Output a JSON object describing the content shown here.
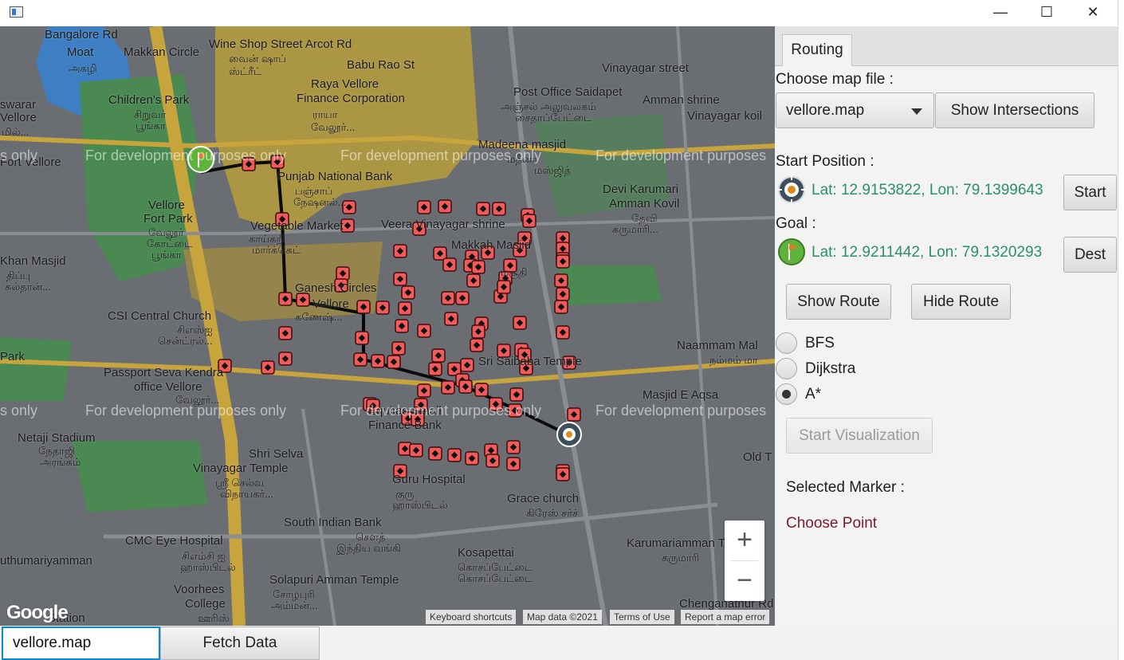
{
  "window": {
    "minimize_glyph": "—",
    "maximize_glyph": "☐",
    "close_glyph": "✕"
  },
  "map": {
    "labels": [
      {
        "id": "bangalore-rd",
        "text": "Bangalore Rd"
      },
      {
        "id": "moat",
        "text": "Moat"
      },
      {
        "id": "moat-tam",
        "text": "அகழி"
      },
      {
        "id": "makkan",
        "text": "Makkan Circle"
      },
      {
        "id": "wine",
        "text": "Wine Shop Street Arcot Rd"
      },
      {
        "id": "wine-tam",
        "text": "வைன் ஷாப்"
      },
      {
        "id": "wine-tam2",
        "text": "ஸ்ட்ரீட்"
      },
      {
        "id": "babu",
        "text": "Babu Rao St"
      },
      {
        "id": "raya",
        "text": "Raya Vellore"
      },
      {
        "id": "raya2",
        "text": "Finance Corporation"
      },
      {
        "id": "raya-tam",
        "text": "ராயா"
      },
      {
        "id": "raya-tam2",
        "text": "வேலூர்..."
      },
      {
        "id": "vinayagar",
        "text": "Vinayagar street"
      },
      {
        "id": "postoffice",
        "text": "Post Office Saidapet"
      },
      {
        "id": "postoffice-tam",
        "text": "அஞ்சல் அலுவலகம்"
      },
      {
        "id": "postoffice-tam2",
        "text": "சைதாப்பேட்டை"
      },
      {
        "id": "amman",
        "text": "Amman shrine"
      },
      {
        "id": "vinayagar-koil",
        "text": "Vinayagar koil"
      },
      {
        "id": "children",
        "text": "Children's Park"
      },
      {
        "id": "children-tam",
        "text": "சிறுவர்"
      },
      {
        "id": "children-tam2",
        "text": "பூங்கா"
      },
      {
        "id": "eswarar",
        "text": "swarar"
      },
      {
        "id": "eswarar2",
        "text": "Vellore"
      },
      {
        "id": "eswarar-tam",
        "text": "மில்..."
      },
      {
        "id": "madeena",
        "text": "Madeena masjid"
      },
      {
        "id": "madeena-tam",
        "text": "மதீனா"
      },
      {
        "id": "madeena-tam2",
        "text": "மஸ்ஜித்"
      },
      {
        "id": "fortvellore",
        "text": "Fort Vellore"
      },
      {
        "id": "punjab",
        "text": "Punjab National Bank"
      },
      {
        "id": "punjab-tam",
        "text": "பஞ்சாப்"
      },
      {
        "id": "punjab-tam2",
        "text": "நேஷனல்..."
      },
      {
        "id": "devi",
        "text": "Devi Karumari"
      },
      {
        "id": "devi2",
        "text": "Amman Kovil"
      },
      {
        "id": "devi-tam",
        "text": "தேவி"
      },
      {
        "id": "devi-tam2",
        "text": "கருமாரி..."
      },
      {
        "id": "fortpark",
        "text": "Vellore"
      },
      {
        "id": "fortpark2",
        "text": "Fort Park"
      },
      {
        "id": "fortpark-tam",
        "text": "வேலூர்"
      },
      {
        "id": "fortpark-tam2",
        "text": "கோட்டை"
      },
      {
        "id": "fortpark-tam3",
        "text": "பூங்கா"
      },
      {
        "id": "vegmarket",
        "text": "Vegetable Market"
      },
      {
        "id": "vegmarket-tam",
        "text": "காய்கறி"
      },
      {
        "id": "vegmarket-tam2",
        "text": "மார்க்கெட்"
      },
      {
        "id": "veera",
        "text": "Veera Vinayagar shrine"
      },
      {
        "id": "makkah",
        "text": "Makkah Masjid"
      },
      {
        "id": "makkah-tam",
        "text": "மசூதி"
      },
      {
        "id": "khan",
        "text": "Khan Masjid"
      },
      {
        "id": "khan-tam",
        "text": "திப்பு"
      },
      {
        "id": "khan-tam2",
        "text": "சுல்தான்..."
      },
      {
        "id": "ganesh",
        "text": "Ganesh Circles"
      },
      {
        "id": "ganesh2",
        "text": "Vellore"
      },
      {
        "id": "ganesh-tam",
        "text": "கணேஷ்..."
      },
      {
        "id": "csi",
        "text": "CSI Central Church"
      },
      {
        "id": "csi-tam",
        "text": "சிஎஸ்ஐ"
      },
      {
        "id": "csi-tam2",
        "text": "சென்ட்ரல்..."
      },
      {
        "id": "naammam",
        "text": "Naammam Mal"
      },
      {
        "id": "naammam-tam",
        "text": "நம்மம் மா"
      },
      {
        "id": "park",
        "text": "Park"
      },
      {
        "id": "passport",
        "text": "Passport Seva Kendra"
      },
      {
        "id": "passport2",
        "text": "office Vellore"
      },
      {
        "id": "passport-tam",
        "text": "வேலூர்..."
      },
      {
        "id": "saibaba",
        "text": "Sri Saibaba Temple"
      },
      {
        "id": "masjid-aqsa",
        "text": "Masjid E Aqsa"
      },
      {
        "id": "equitas",
        "text": "Equitas Small"
      },
      {
        "id": "equitas2",
        "text": "Finance Bank"
      },
      {
        "id": "netaji",
        "text": "Netaji Stadium"
      },
      {
        "id": "netaji-tam",
        "text": "நேதாஜி"
      },
      {
        "id": "netaji-tam2",
        "text": "அரங்கம்"
      },
      {
        "id": "shriselva",
        "text": "Shri Selva"
      },
      {
        "id": "shriselva2",
        "text": "Vinayagar Temple"
      },
      {
        "id": "shriselva-tam",
        "text": "ஸ்ரீ செல்வ"
      },
      {
        "id": "shriselva-tam2",
        "text": "விநாயகர்..."
      },
      {
        "id": "guru",
        "text": "Guru Hospital"
      },
      {
        "id": "guru-tam",
        "text": "குரு"
      },
      {
        "id": "guru-tam2",
        "text": "ஹாஸ்பிடல்"
      },
      {
        "id": "oldt",
        "text": "Old T"
      },
      {
        "id": "grace",
        "text": "Grace church"
      },
      {
        "id": "grace-tam",
        "text": "கிரேஸ் சர்ச்"
      },
      {
        "id": "sib",
        "text": "South Indian Bank"
      },
      {
        "id": "sib-tam",
        "text": "சௌத்"
      },
      {
        "id": "sib-tam2",
        "text": "இந்திய வங்கி"
      },
      {
        "id": "cmc",
        "text": "CMC Eye Hospital"
      },
      {
        "id": "cmc-tam",
        "text": "சிஎம்சி ஐ"
      },
      {
        "id": "cmc-tam2",
        "text": "ஹாஸ்பிடல்"
      },
      {
        "id": "kosapettai",
        "text": "Kosapettai"
      },
      {
        "id": "kosapettai-tam",
        "text": "கொசப்பேட்டை"
      },
      {
        "id": "kosapettai-tam2",
        "text": "கொசப்பேட்டை"
      },
      {
        "id": "karumariamman",
        "text": "Karumariamman Te"
      },
      {
        "id": "karumariamman-tam",
        "text": "கருமாரி"
      },
      {
        "id": "uthumar",
        "text": "uthumariyamman"
      },
      {
        "id": "solapuri",
        "text": "Solapuri Amman Temple"
      },
      {
        "id": "solapuri-tam",
        "text": "சோழபுரி"
      },
      {
        "id": "solapuri-tam2",
        "text": "அம்மன்..."
      },
      {
        "id": "voorhees",
        "text": "Voorhees"
      },
      {
        "id": "voorhees2",
        "text": "College"
      },
      {
        "id": "voorhees-tam",
        "text": "ஊரிஸ்"
      },
      {
        "id": "station",
        "text": "Station"
      },
      {
        "id": "chengan",
        "text": "Chenganathur Rd"
      }
    ],
    "watermarks": [
      "s only",
      "For development purposes only",
      "For development purposes only",
      "For development purposes",
      "s only",
      "For development purposes only",
      "For development purposes only",
      "For development purposes"
    ],
    "zoom_in": "+",
    "zoom_out": "−",
    "google_logo": "Google",
    "attributions": [
      "Keyboard shortcuts",
      "Map data ©2021",
      "Terms of Use",
      "Report a map error"
    ],
    "colors": {
      "marker_fill": "#f05a5a",
      "route": "#0a0a0a",
      "roads": "#c8a43c",
      "park": "#4a8a52",
      "water": "#3d7fc2"
    }
  },
  "bottom": {
    "file_value": "vellore.map",
    "fetch_label": "Fetch Data"
  },
  "panel": {
    "tab_label": "Routing",
    "choose_map_label": "Choose map file :",
    "map_select_value": "vellore.map",
    "show_intersections": "Show Intersections",
    "start_position_label": "Start Position :",
    "start_coords": "Lat: 12.9153822, Lon: 79.1399643",
    "start_button": "Start",
    "goal_label": "Goal :",
    "goal_coords": "Lat: 12.9211442, Lon: 79.1320293",
    "dest_button": "Dest",
    "show_route": "Show Route",
    "hide_route": "Hide Route",
    "algorithms": [
      {
        "label": "BFS",
        "selected": false
      },
      {
        "label": "Dijkstra",
        "selected": false
      },
      {
        "label": "A*",
        "selected": true
      }
    ],
    "start_visualization": "Start Visualization",
    "selected_marker_label": "Selected Marker :",
    "choose_point": "Choose Point"
  }
}
